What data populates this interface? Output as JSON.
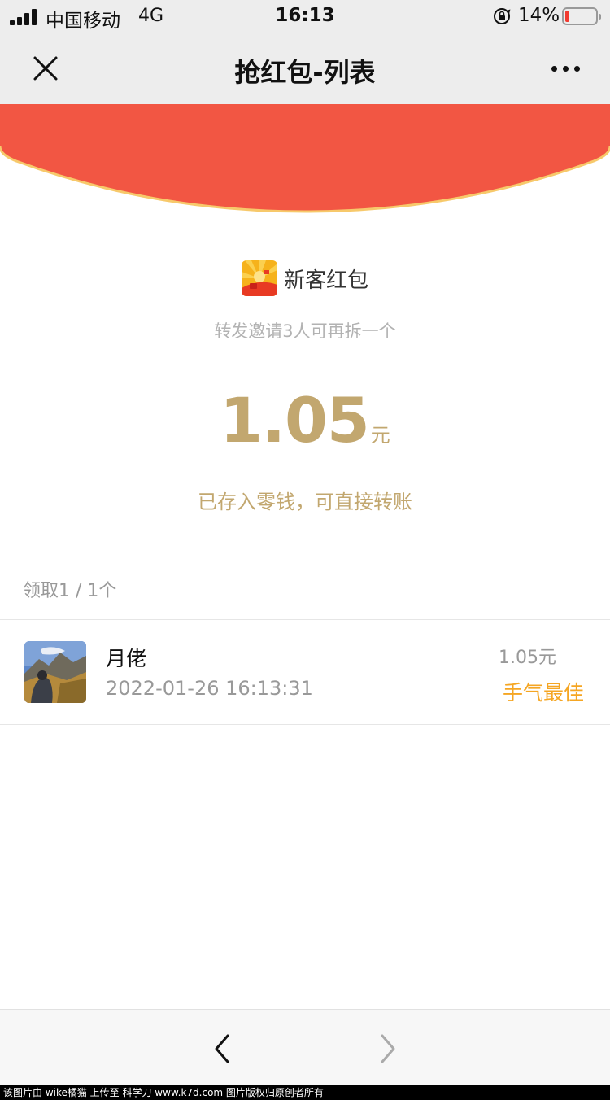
{
  "status": {
    "carrier": "中国移动",
    "network": "4G",
    "time": "16:13",
    "battery_percent": "14%",
    "battery_level": 0.14,
    "battery_color": "#f23a2f"
  },
  "nav": {
    "title": "抢红包-列表",
    "close_icon": "close-icon",
    "more_icon": "more-icon"
  },
  "header": {
    "color": "#f25643",
    "edge_color": "#f7c96b"
  },
  "packet": {
    "brand": "新客红包",
    "hint": "转发邀请3人可再拆一个",
    "amount": "1.05",
    "unit": "元",
    "stored_text": "已存入零钱，可直接转账",
    "amount_color": "#c2a76f"
  },
  "receive_count": "领取1 / 1个",
  "records": [
    {
      "name": "月佬",
      "time": "2022-01-26 16:13:31",
      "amount": "1.05元",
      "badge": "手气最佳"
    }
  ],
  "toolbar": {
    "back_icon": "chevron-left-icon",
    "forward_icon": "chevron-right-icon"
  },
  "watermark": "该图片由 wike橘猫 上传至 科学刀 www.k7d.com 图片版权归原创者所有"
}
